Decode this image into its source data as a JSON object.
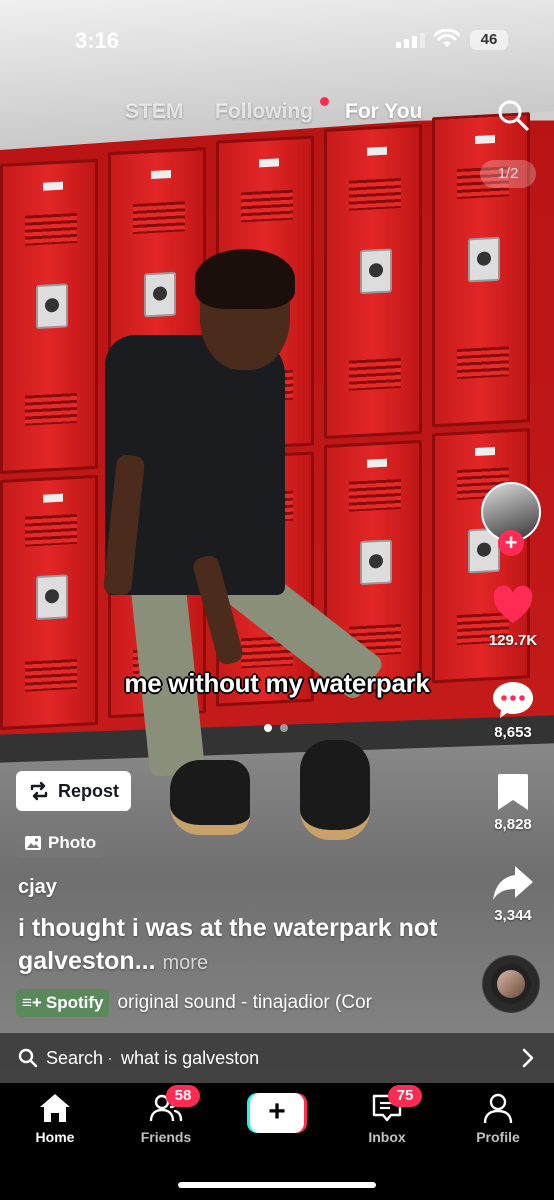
{
  "status_bar": {
    "time": "3:16",
    "battery": "46"
  },
  "top_nav": {
    "tabs": [
      {
        "label": "STEM"
      },
      {
        "label": "Following"
      },
      {
        "label": "For You"
      }
    ],
    "active_tab": "For You"
  },
  "post": {
    "image_counter": "1/2",
    "overlay_caption": "me without my waterpark",
    "repost_label": "Repost",
    "photo_label": "Photo",
    "username": "cjay",
    "description": "i thought i was at the waterpark not galveston...",
    "more_label": "more",
    "spotify_label": "Spotify",
    "sound": "original sound - tinajadior (Cor"
  },
  "actions": {
    "likes": "129.7K",
    "comments": "8,653",
    "saves": "8,828",
    "shares": "3,344"
  },
  "search_bar": {
    "label": "Search",
    "separator": "·",
    "query": "what is galveston"
  },
  "tab_bar": {
    "items": [
      {
        "label": "Home"
      },
      {
        "label": "Friends",
        "badge": "58"
      },
      {
        "label": ""
      },
      {
        "label": "Inbox",
        "badge": "75"
      },
      {
        "label": "Profile"
      }
    ]
  },
  "colors": {
    "accent": "#fe2c55",
    "cyan": "#25f4ee",
    "tab_bar_bg": "#000000"
  },
  "icons": [
    "search-icon",
    "heart-icon",
    "comment-icon",
    "bookmark-icon",
    "share-icon",
    "repost-icon",
    "photo-icon",
    "home-icon",
    "friends-icon",
    "plus-icon",
    "inbox-icon",
    "profile-icon",
    "chevron-right-icon"
  ]
}
